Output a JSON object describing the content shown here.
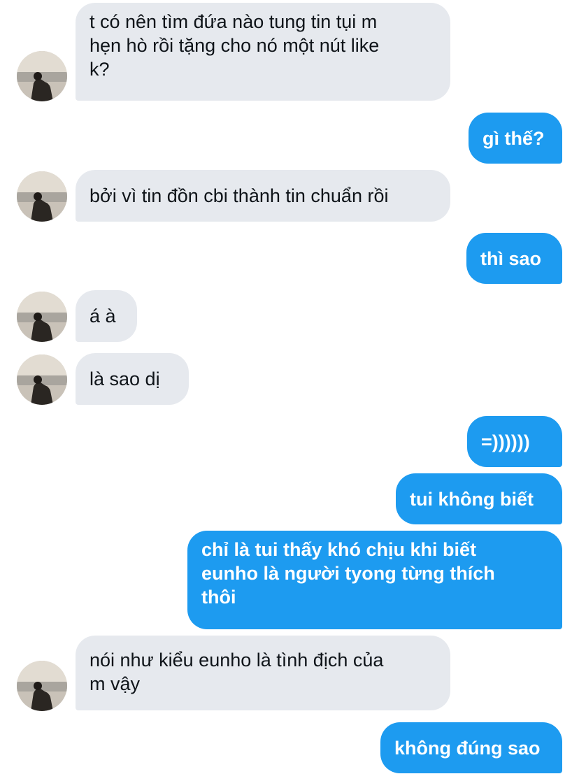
{
  "conversation": {
    "messages": [
      {
        "from": "them",
        "text": "t có nên tìm đứa nào tung tin tụi m\nhẹn hò rồi tặng cho nó một nút like\nk?"
      },
      {
        "from": "me",
        "text": "gì thế?"
      },
      {
        "from": "them",
        "text": "bởi vì tin đồn cbi thành tin chuẩn rồi"
      },
      {
        "from": "me",
        "text": "thì sao"
      },
      {
        "from": "them",
        "text": "á à"
      },
      {
        "from": "them",
        "text": "là sao dị"
      },
      {
        "from": "me",
        "text": "=))))))"
      },
      {
        "from": "me",
        "text": "tui không biết"
      },
      {
        "from": "me",
        "text": "chỉ là tui thấy khó chịu khi biết\neunho là người tyong từng thích\nthôi"
      },
      {
        "from": "them",
        "text": "nói như kiểu eunho là tình địch của\nm vậy"
      },
      {
        "from": "me",
        "text": "không đúng sao"
      }
    ]
  },
  "colors": {
    "incoming_bubble": "#e6e9ee",
    "outgoing_bubble": "#1d9bf0",
    "incoming_text": "#0f1419",
    "outgoing_text": "#ffffff"
  },
  "icons": {
    "avatar": "user-avatar-photo"
  }
}
